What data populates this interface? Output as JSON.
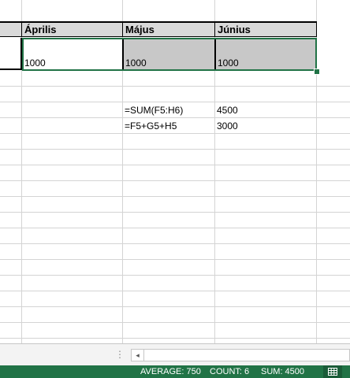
{
  "headers": {
    "c1": "Április",
    "c2": "Május",
    "c3": "Június"
  },
  "row5": {
    "c1": "1000",
    "c2": "1000",
    "c3": "1000"
  },
  "formulas": [
    {
      "text": "=SUM(F5:H6)",
      "result": "4500"
    },
    {
      "text": "=F5+G5+H5",
      "result": "3000"
    }
  ],
  "status": {
    "average": "AVERAGE: 750",
    "count": "COUNT: 6",
    "sum": "SUM: 4500"
  },
  "icons": {
    "scroll_left": "◂",
    "sheet_menu": "⋮",
    "normal_view": "grid-icon"
  },
  "colors": {
    "accent": "#217346",
    "selection_fill": "#c8c8c8",
    "header_fill": "#d9d9d9"
  }
}
